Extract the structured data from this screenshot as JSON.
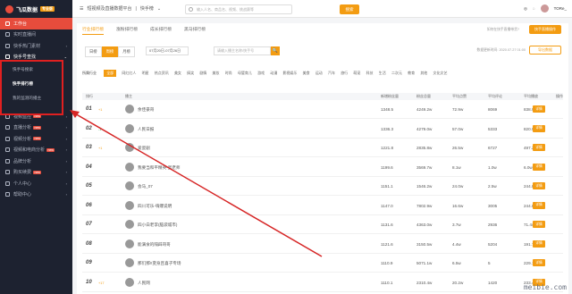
{
  "app": {
    "logo": "飞瓜数据",
    "logo_sub": "FEIGUA.CN",
    "tag": "专业版"
  },
  "sidebar": {
    "items": [
      {
        "label": "工作台",
        "active": true
      },
      {
        "label": "实时直播间"
      },
      {
        "label": "快手热门素材",
        "chevron": "›"
      },
      {
        "label": "快手号查找",
        "chevron": "⌄"
      }
    ],
    "subitems": [
      "快手号搜索",
      "快手排行榜",
      "我的监测的播主"
    ],
    "items2": [
      {
        "label": "视频监控",
        "new": true,
        "chevron": "›"
      },
      {
        "label": "直播分析",
        "new": true,
        "chevron": "›"
      },
      {
        "label": "视频分析",
        "new": true,
        "chevron": "›"
      },
      {
        "label": "视频和电商分析",
        "new": true,
        "chevron": "›"
      },
      {
        "label": "品牌分析",
        "chevron": "›"
      },
      {
        "label": "购买续费",
        "new": true,
        "chevron": "›"
      },
      {
        "label": "个人中心",
        "chevron": "›"
      },
      {
        "label": "帮助中心",
        "chevron": "›"
      }
    ]
  },
  "topbar": {
    "crumb1": "短视频及直播数据平台",
    "crumb2": "快手榜",
    "search_placeholder": "输入人名、商品名、视频、挑战赛等",
    "search_button": "搜索",
    "user": "TORe_"
  },
  "tabs": [
    "行业排行榜",
    "涨粉排行榜",
    "成长排行榜",
    "黑马排行榜"
  ],
  "right_note": "如何在快手直播带货?",
  "qa_button": "快手直播操作",
  "period": [
    "日榜",
    "周榜",
    "月榜"
  ],
  "date": "07月20日-07月26日",
  "anchor_placeholder": "请输入播主名称/快手号",
  "anchor_btn": "🔍",
  "update_info": "数据更新时间: 2020.07.27 01:00",
  "export_button": "导出数据",
  "categories": {
    "label": "所属行业",
    "items": [
      "全部",
      "网红红人",
      "明星",
      "热点资讯",
      "美女",
      "搞笑",
      "剧情",
      "美妆",
      "时尚",
      "母婴育儿",
      "游戏",
      "动漫",
      "影视娱乐",
      "美食",
      "运动",
      "汽车",
      "旅行",
      "萌宠",
      "科技",
      "生活",
      "二次元",
      "教育",
      "其他",
      "文化文艺"
    ]
  },
  "table": {
    "headers": [
      "排行",
      "播主",
      "新增粉丝量",
      "粉丝总量",
      "平均点赞",
      "平均评论",
      "平均播放",
      "操作"
    ]
  },
  "rows": [
    {
      "rank": "01",
      "chg": "+1",
      "name": "余佳豪哥",
      "a": "1348.5",
      "b": "4249.2w",
      "c": "72.9w",
      "d": "8069",
      "e": "838.9w",
      "btn": "详情"
    },
    {
      "rank": "02",
      "chg": "-1",
      "name": "人民日报",
      "a": "1336.3",
      "b": "4279.0w",
      "c": "57.0w",
      "d": "5333",
      "e": "820.9w",
      "btn": "详情"
    },
    {
      "rank": "03",
      "chg": "+1",
      "name": "爱瓷剧",
      "a": "1221.8",
      "b": "2835.8w",
      "c": "26.5w",
      "d": "6727",
      "e": "497.2w",
      "btn": "详情"
    },
    {
      "rank": "04",
      "chg": "",
      "name": "我要当和平精英·蛋老师",
      "a": "1199.6",
      "b": "3569.7w",
      "c": "8.1w",
      "d": "1.0w",
      "e": "6.0w",
      "btn": "详情"
    },
    {
      "rank": "05",
      "chg": "",
      "name": "会马_07",
      "a": "1151.1",
      "b": "1546.2w",
      "c": "24.0w",
      "d": "2.5w",
      "e": "244.8w",
      "btn": "详情"
    },
    {
      "rank": "06",
      "chg": "",
      "name": "四川可乐-嗨爆说明",
      "a": "1147.0",
      "b": "7802.9w",
      "c": "16.6w",
      "d": "3005",
      "e": "244.8w",
      "btn": "详情"
    },
    {
      "rank": "07",
      "chg": "",
      "name": "四小白老李(脑袋城市)",
      "a": "1131.6",
      "b": "4363.0w",
      "c": "3.7w",
      "d": "2936",
      "e": "71.4w",
      "btn": "详情"
    },
    {
      "rank": "08",
      "chg": "",
      "name": "能满食的隔辟哥哥",
      "a": "1121.6",
      "b": "3150.5w",
      "c": "4.4w",
      "d": "5204",
      "e": "191.7w",
      "btn": "详情"
    },
    {
      "rank": "09",
      "chg": "",
      "name": "那们那!!变身且喜子专场",
      "a": "1110.9",
      "b": "5071.1w",
      "c": "6.5w",
      "d": "5",
      "e": "229.1w",
      "btn": "详情"
    },
    {
      "rank": "10",
      "chg": "+17",
      "name": "人民网",
      "a": "1110.1",
      "b": "2310.4w",
      "c": "20.2w",
      "d": "1420",
      "e": "233.4w",
      "btn": "详情"
    }
  ],
  "watermark": "meibie.com"
}
